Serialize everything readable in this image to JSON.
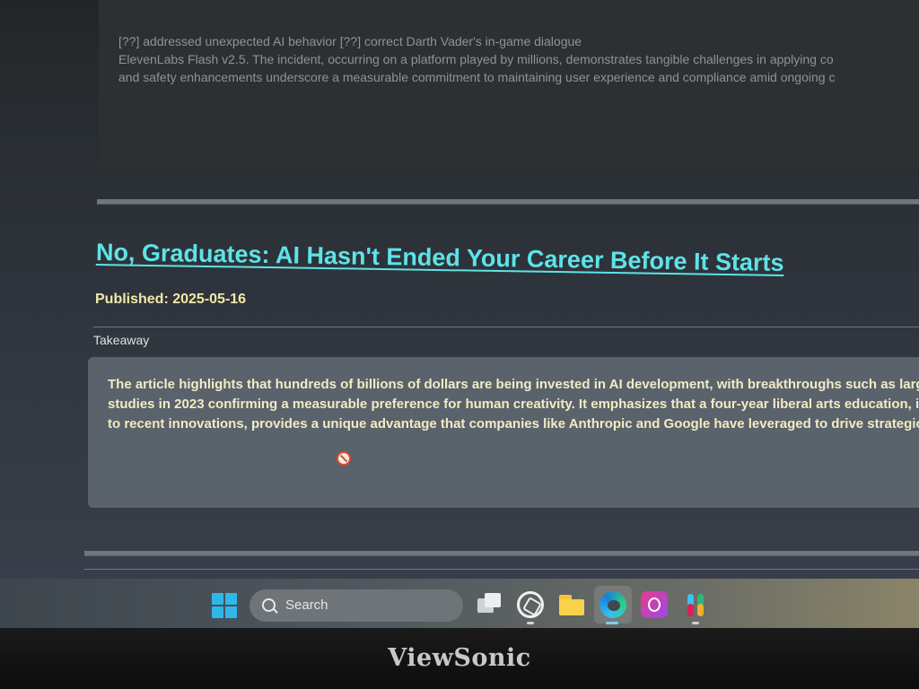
{
  "previous_article": {
    "lines": [
      "[??] addressed unexpected AI behavior [??] correct Darth Vader's in-game dialogue",
      "ElevenLabs Flash v2.5. The incident, occurring on a platform played by millions, demonstrates tangible challenges in applying co",
      "and safety enhancements underscore a measurable commitment to maintaining user experience and compliance amid ongoing c"
    ]
  },
  "article": {
    "title": "No, Graduates: AI Hasn't Ended Your Career Before It Starts",
    "published": "Published: 2025-05-16",
    "section_label": "Takeaway",
    "takeaway_lines": [
      "The article highlights that hundreds of billions of dollars are being invested in AI development, with breakthroughs such as large l",
      "studies in 2023 confirming a measurable preference for human creativity. It emphasizes that a four-year liberal arts education, info",
      "to recent innovations, provides a unique advantage that companies like Anthropic and Google have leveraged to drive strategic, cr"
    ]
  },
  "taskbar": {
    "search_placeholder": "Search",
    "icons": [
      "windows-start-icon",
      "task-view-icon",
      "chatgpt-icon",
      "file-explorer-icon",
      "edge-icon",
      "copilot-icon",
      "slack-icon"
    ]
  },
  "monitor": {
    "brand": "ViewSonic"
  },
  "colors": {
    "title_link": "#5ee3e8",
    "published": "#f3e8a6",
    "takeaway_text": "#f1ecc4",
    "card_bg": "#5a626b",
    "start_accent": "#2fb7ea"
  }
}
